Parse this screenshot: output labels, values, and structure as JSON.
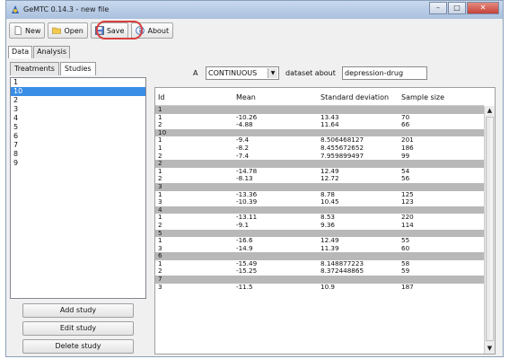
{
  "window": {
    "title": "GeMTC 0.14.3 - new file",
    "controls": [
      "–",
      "□",
      "✕"
    ]
  },
  "toolbar": {
    "new_label": "New",
    "open_label": "Open",
    "save_label": "Save",
    "about_label": "About"
  },
  "main_tabs": [
    "Data",
    "Analysis"
  ],
  "sub_tabs": [
    "Treatments",
    "Studies"
  ],
  "studies": [
    "1",
    "10",
    "2",
    "3",
    "4",
    "5",
    "6",
    "7",
    "8",
    "9"
  ],
  "selected_study": "10",
  "buttons": {
    "add_study": "Add study",
    "edit_study": "Edit study",
    "delete_study": "Delete study"
  },
  "dataset": {
    "prefix": "A",
    "type_value": "CONTINUOUS",
    "middle": "dataset about",
    "about_value": "depression-drug"
  },
  "table": {
    "columns": [
      "Id",
      "Mean",
      "Standard deviation",
      "Sample size"
    ],
    "groups": [
      {
        "study": "1",
        "rows": [
          [
            "1",
            "-10.26",
            "13.43",
            "70"
          ],
          [
            "2",
            "-4.88",
            "11.64",
            "66"
          ]
        ]
      },
      {
        "study": "10",
        "rows": [
          [
            "1",
            "-9.4",
            "8.506468127",
            "201"
          ],
          [
            "1",
            "-8.2",
            "8.455672652",
            "186"
          ],
          [
            "2",
            "-7.4",
            "7.959899497",
            "99"
          ]
        ]
      },
      {
        "study": "2",
        "rows": [
          [
            "1",
            "-14.78",
            "12.49",
            "54"
          ],
          [
            "2",
            "-8.13",
            "12.72",
            "56"
          ]
        ]
      },
      {
        "study": "3",
        "rows": [
          [
            "1",
            "-13.36",
            "8.78",
            "125"
          ],
          [
            "3",
            "-10.39",
            "10.45",
            "123"
          ]
        ]
      },
      {
        "study": "4",
        "rows": [
          [
            "1",
            "-13.11",
            "8.53",
            "220"
          ],
          [
            "2",
            "-9.1",
            "9.36",
            "114"
          ]
        ]
      },
      {
        "study": "5",
        "rows": [
          [
            "1",
            "-16.6",
            "12.49",
            "55"
          ],
          [
            "3",
            "-14.9",
            "11.39",
            "60"
          ]
        ]
      },
      {
        "study": "6",
        "rows": [
          [
            "1",
            "-15.49",
            "8.148877223",
            "58"
          ],
          [
            "2",
            "-15.25",
            "8.372448865",
            "59"
          ]
        ]
      },
      {
        "study": "7",
        "rows": [
          [
            "3",
            "-11.5",
            "10.9",
            "187"
          ]
        ]
      }
    ]
  },
  "colors": {
    "selection": "#3a8ee6",
    "group_row": "#b8b8b8",
    "save_highlight": "#d84040"
  }
}
